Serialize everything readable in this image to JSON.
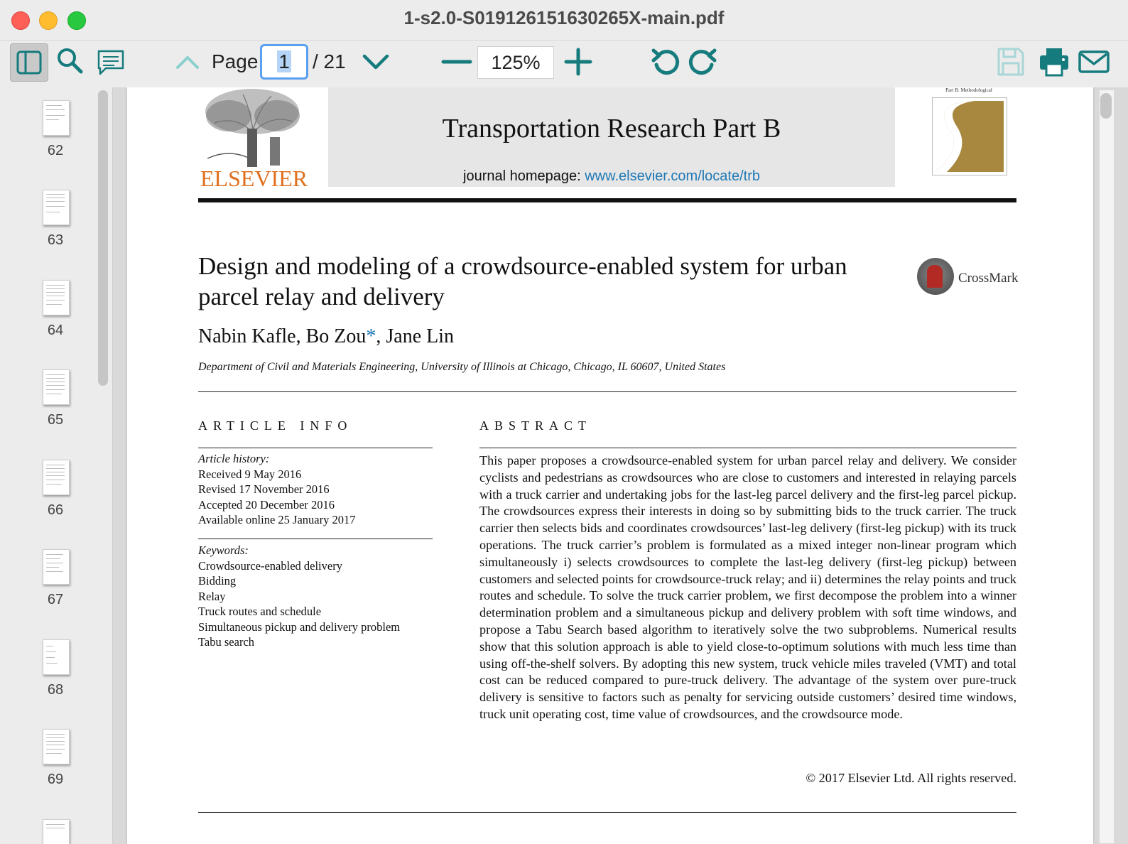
{
  "window": {
    "title": "1-s2.0-S019126151630265X-main.pdf"
  },
  "toolbar": {
    "page_label": "Page",
    "current_page": "1",
    "total_pages": "/ 21",
    "zoom": "125%"
  },
  "thumbnails": [
    "62",
    "63",
    "64",
    "65",
    "66",
    "67",
    "68",
    "69"
  ],
  "document": {
    "journal": "Transportation Research Part B",
    "homepage_label": "journal homepage: ",
    "homepage_url": "www.elsevier.com/locate/trb",
    "publisher": "ELSEVIER",
    "cover_label": "Part B: Methodological",
    "title": "Design and modeling of a crowdsource-enabled system for urban parcel relay and delivery",
    "authors_a": "Nabin Kafle, Bo Zou",
    "authors_star": "*",
    "authors_b": ", Jane Lin",
    "affiliation": "Department of Civil and Materials Engineering, University of Illinois at Chicago, Chicago, IL 60607, United States",
    "crossmark": "CrossMark",
    "article_info_heading": "ARTICLE INFO",
    "abstract_heading": "ABSTRACT",
    "history_label": "Article history:",
    "history": [
      "Received 9 May 2016",
      "Revised 17 November 2016",
      "Accepted 20 December 2016",
      "Available online 25 January 2017"
    ],
    "keywords_label": "Keywords:",
    "keywords": [
      "Crowdsource-enabled delivery",
      "Bidding",
      "Relay",
      "Truck routes and schedule",
      "Simultaneous pickup and delivery problem",
      "Tabu search"
    ],
    "abstract": "This paper proposes a crowdsource-enabled system for urban parcel relay and delivery. We consider cyclists and pedestrians as crowdsources who are close to customers and interested in relaying parcels with a truck carrier and undertaking jobs for the last-leg parcel delivery and the first-leg parcel pickup. The crowdsources express their interests in doing so by submitting bids to the truck carrier. The truck carrier then selects bids and coordinates crowdsources’ last-leg delivery (first-leg pickup) with its truck operations. The truck carrier’s problem is formulated as a mixed integer non-linear program which simultaneously i) selects crowdsources to complete the last-leg delivery (first-leg pickup) between customers and selected points for crowdsource-truck relay; and ii) determines the relay points and truck routes and schedule. To solve the truck carrier problem, we first decompose the problem into a winner determination problem and a simultaneous pickup and delivery problem with soft time windows, and propose a Tabu Search based algorithm to iteratively solve the two subproblems. Numerical results show that this solution approach is able to yield close-to-optimum solutions with much less time than using off-the-shelf solvers. By adopting this new system, truck vehicle miles traveled (VMT) and total cost can be reduced compared to pure-truck delivery. The advantage of the system over pure-truck delivery is sensitive to factors such as penalty for servicing outside customers’ desired time windows, truck unit operating cost, time value of crowdsources, and the crowdsource mode.",
    "copyright": "© 2017 Elsevier Ltd. All rights reserved."
  },
  "colors": {
    "accent_teal": "#167b7d",
    "link_blue": "#1f78b4",
    "elsevier_orange": "#e0701e",
    "focus_blue": "#5aa0f0"
  }
}
